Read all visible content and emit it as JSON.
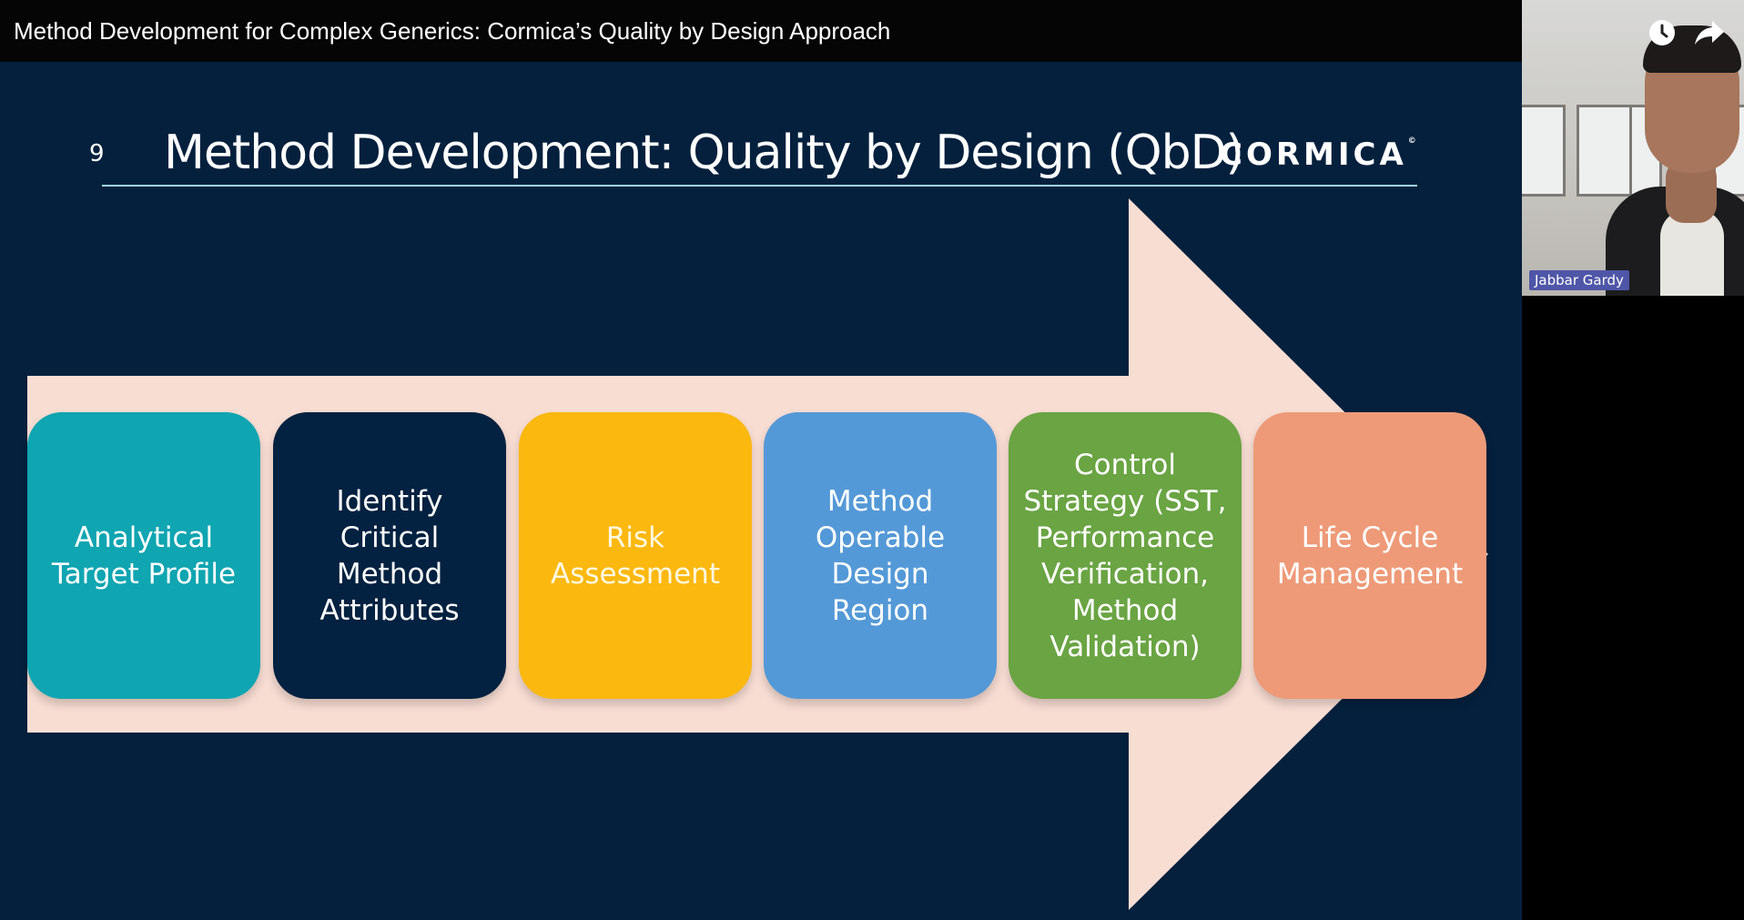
{
  "video": {
    "title": "Method Development for Complex Generics: Cormica’s Quality by Design Approach"
  },
  "slide": {
    "number": "9",
    "title": "Method Development: Quality by Design (QbD)",
    "logo": "CORMICA",
    "logo_mark": "©",
    "arrow_color": "#f8ddd3",
    "background": "#04203d",
    "steps": [
      {
        "label": "Analytical\nTarget Profile",
        "color": "#0fa5b1",
        "text_color": "#ffffff"
      },
      {
        "label": "Identify\nCritical\nMethod\nAttributes",
        "color": "#032140",
        "text_color": "#ffffff"
      },
      {
        "label": "Risk\nAssessment",
        "color": "#fbb80f",
        "text_color": "#fff8e0"
      },
      {
        "label": "Method\nOperable\nDesign\nRegion",
        "color": "#5499d7",
        "text_color": "#ffffff"
      },
      {
        "label": "Control\nStrategy (SST,\nPerformance\nVerification,\nMethod\nValidation)",
        "color": "#6aa443",
        "text_color": "#ffffff"
      },
      {
        "label": "Life Cycle\nManagement",
        "color": "#ee9a78",
        "text_color": "#ffffff"
      }
    ]
  },
  "webcam": {
    "participant_name": "Jabbar Gardy",
    "icons": [
      "watch-later-icon",
      "share-icon"
    ]
  }
}
